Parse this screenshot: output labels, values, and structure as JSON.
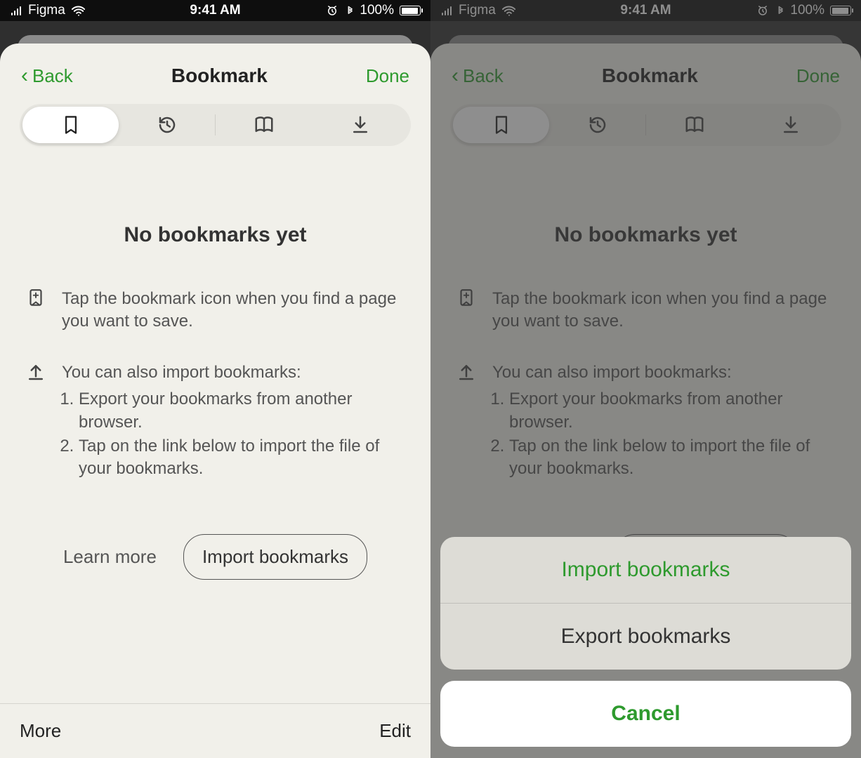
{
  "statusbar": {
    "carrier": "Figma",
    "time": "9:41 AM",
    "battery_pct": "100%"
  },
  "nav": {
    "back": "Back",
    "title": "Bookmark",
    "done": "Done"
  },
  "segments": {
    "bookmark": "bookmark-icon",
    "history": "history-icon",
    "reading": "book-open-icon",
    "downloads": "download-icon"
  },
  "empty": {
    "title": "No bookmarks yet",
    "tip1": "Tap the bookmark icon when you find a page you want to save.",
    "tip2_intro": "You can also import bookmarks:",
    "step1": "Export your bookmarks from another browser.",
    "step2": "Tap on the link below to import the file of your bookmarks."
  },
  "actions": {
    "learn_more": "Learn more",
    "import": "Import bookmarks"
  },
  "toolbar": {
    "more": "More",
    "edit": "Edit"
  },
  "sheet": {
    "import": "Import bookmarks",
    "export": "Export bookmarks",
    "cancel": "Cancel"
  },
  "colors": {
    "accent_green": "#2e9a2e",
    "sheet_bg": "#f1f0ea"
  }
}
